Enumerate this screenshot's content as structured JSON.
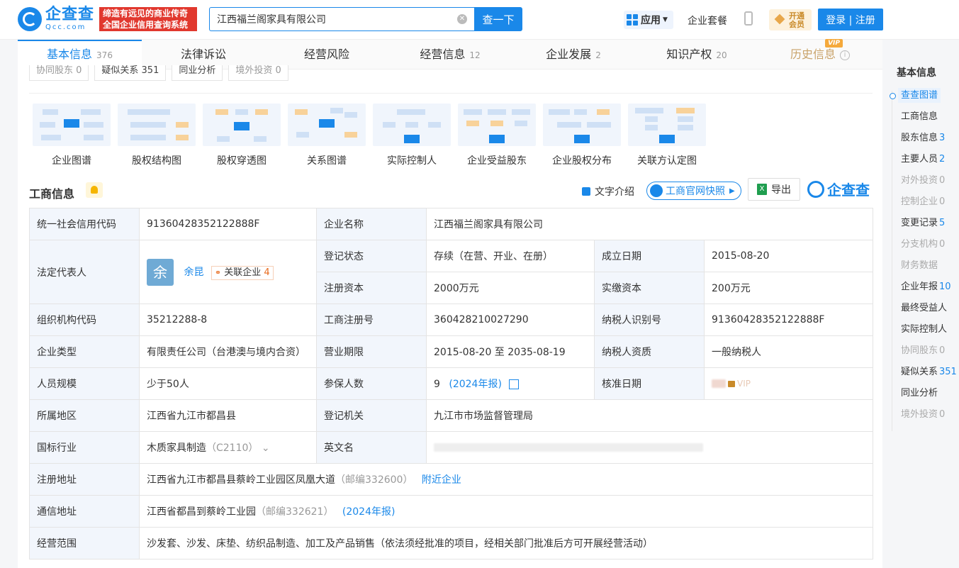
{
  "header": {
    "logo_cn": "企查查",
    "logo_en": "Qcc.com",
    "slogan_line1": "缔造有远见的商业传奇",
    "slogan_line2": "全国企业信用查询系统",
    "search_value": "江西福兰阁家具有限公司",
    "search_button": "查一下",
    "apps_label": "应用",
    "suite_label": "企业套餐",
    "vip_label1": "开通",
    "vip_label2": "会员",
    "login_label": "登录 | 注册"
  },
  "tabs": [
    {
      "label": "基本信息",
      "count": "376"
    },
    {
      "label": "法律诉讼",
      "count": ""
    },
    {
      "label": "经营风险",
      "count": ""
    },
    {
      "label": "经营信息",
      "count": "12"
    },
    {
      "label": "企业发展",
      "count": "2"
    },
    {
      "label": "知识产权",
      "count": "20"
    },
    {
      "label": "历史信息",
      "count": "",
      "badge": "VIP"
    }
  ],
  "chips": [
    {
      "label": "协同股东 0"
    },
    {
      "label": "疑似关系 351"
    },
    {
      "label": "同业分析"
    },
    {
      "label": "境外投资 0"
    }
  ],
  "graphs": [
    {
      "label": "企业图谱"
    },
    {
      "label": "股权结构图"
    },
    {
      "label": "股权穿透图"
    },
    {
      "label": "关系图谱"
    },
    {
      "label": "实际控制人"
    },
    {
      "label": "企业受益股东"
    },
    {
      "label": "企业股权分布"
    },
    {
      "label": "关联方认定图"
    }
  ],
  "section": {
    "title": "工商信息",
    "text_intro": "文字介绍",
    "snapshot": "工商官网快照",
    "export": "导出",
    "brand": "企查查"
  },
  "info": {
    "credit_code_label": "统一社会信用代码",
    "credit_code": "91360428352122888F",
    "name_label": "企业名称",
    "name": "江西福兰阁家具有限公司",
    "legal_label": "法定代表人",
    "legal_avatar": "余",
    "legal_name": "余昆",
    "related_label": "关联企业",
    "related_count": "4",
    "status_label": "登记状态",
    "status": "存续（在营、开业、在册）",
    "found_label": "成立日期",
    "found": "2015-08-20",
    "capital_label": "注册资本",
    "capital": "2000万元",
    "paid_label": "实缴资本",
    "paid": "200万元",
    "org_code_label": "组织机构代码",
    "org_code": "35212288-8",
    "reg_no_label": "工商注册号",
    "reg_no": "360428210027290",
    "tax_id_label": "纳税人识别号",
    "tax_id": "91360428352122888F",
    "type_label": "企业类型",
    "type": "有限责任公司（台港澳与境内合资）",
    "term_label": "营业期限",
    "term": "2015-08-20 至 2035-08-19",
    "taxpayer_label": "纳税人资质",
    "taxpayer": "一般纳税人",
    "staff_label": "人员规模",
    "staff": "少于50人",
    "insured_label": "参保人数",
    "insured": "9",
    "insured_year": "(2024年报)",
    "approve_label": "核准日期",
    "approve_vip": "VIP",
    "region_label": "所属地区",
    "region": "江西省九江市都昌县",
    "authority_label": "登记机关",
    "authority": "九江市市场监督管理局",
    "industry_label": "国标行业",
    "industry": "木质家具制造",
    "industry_code": "（C2110）",
    "en_name_label": "英文名",
    "reg_addr_label": "注册地址",
    "reg_addr": "江西省九江市都昌县蔡岭工业园区凤凰大道",
    "reg_zip": "（邮编332600）",
    "nearby": "附近企业",
    "mail_addr_label": "通信地址",
    "mail_addr": "江西省都昌到蔡岭工业园",
    "mail_zip": "（邮编332621）",
    "mail_year": "(2024年报)",
    "scope_label": "经营范围",
    "scope": "沙发套、沙发、床垫、纺织品制造、加工及产品销售（依法须经批准的项目，经相关部门批准后方可开展经营活动）"
  },
  "sidebar": {
    "title": "基本信息",
    "items": [
      {
        "label": "查查图谱",
        "count": "",
        "state": "active"
      },
      {
        "label": "工商信息",
        "count": "",
        "state": "normal"
      },
      {
        "label": "股东信息",
        "count": "3",
        "state": "normal"
      },
      {
        "label": "主要人员",
        "count": "2",
        "state": "normal"
      },
      {
        "label": "对外投资",
        "count": "0",
        "state": "disabled"
      },
      {
        "label": "控制企业",
        "count": "0",
        "state": "disabled"
      },
      {
        "label": "变更记录",
        "count": "5",
        "state": "normal"
      },
      {
        "label": "分支机构",
        "count": "0",
        "state": "disabled"
      },
      {
        "label": "财务数据",
        "count": "",
        "state": "disabled"
      },
      {
        "label": "企业年报",
        "count": "10",
        "state": "normal"
      },
      {
        "label": "最终受益人",
        "count": "",
        "state": "normal"
      },
      {
        "label": "实际控制人",
        "count": "",
        "state": "normal"
      },
      {
        "label": "协同股东",
        "count": "0",
        "state": "disabled"
      },
      {
        "label": "疑似关系",
        "count": "351",
        "state": "normal"
      },
      {
        "label": "同业分析",
        "count": "",
        "state": "normal"
      },
      {
        "label": "境外投资",
        "count": "0",
        "state": "disabled"
      }
    ]
  },
  "colors": {
    "accent": "#1a88e9",
    "slogan_bg": "#e1382e",
    "label_bg": "#f2f6fc"
  }
}
